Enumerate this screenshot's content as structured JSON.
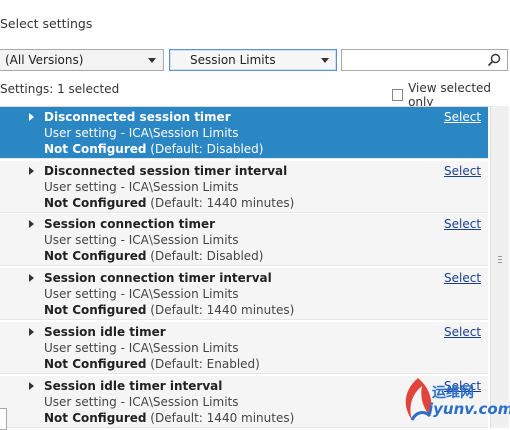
{
  "header": {
    "title": "Select settings"
  },
  "filters": {
    "version": "(All Versions)",
    "category": "Session Limits",
    "search_value": ""
  },
  "status": {
    "settings_count": "Settings:  1 selected",
    "view_selected_label": "View selected only"
  },
  "settings": [
    {
      "name": "Disconnected session timer",
      "path": "User setting - ICA\\Session Limits",
      "state_bold": "Not Configured",
      "state_default": " (Default: Disabled)",
      "action": "Select"
    },
    {
      "name": "Disconnected session timer interval",
      "path": "User setting - ICA\\Session Limits",
      "state_bold": "Not Configured",
      "state_default": " (Default: 1440 minutes)",
      "action": "Select"
    },
    {
      "name": "Session connection timer",
      "path": "User setting - ICA\\Session Limits",
      "state_bold": "Not Configured",
      "state_default": " (Default: Disabled)",
      "action": "Select"
    },
    {
      "name": "Session connection timer interval",
      "path": "User setting - ICA\\Session Limits",
      "state_bold": "Not Configured",
      "state_default": " (Default: 1440 minutes)",
      "action": "Select"
    },
    {
      "name": "Session idle timer",
      "path": "User setting - ICA\\Session Limits",
      "state_bold": "Not Configured",
      "state_default": " (Default: Enabled)",
      "action": "Select"
    },
    {
      "name": "Session idle timer interval",
      "path": "User setting - ICA\\Session Limits",
      "state_bold": "Not Configured",
      "state_default": " (Default: 1440 minutes)",
      "action": "Select"
    }
  ],
  "watermark": {
    "line1": "运维网",
    "line2": "iyunv.com"
  },
  "colors": {
    "selected_row": "#2b86c4",
    "row_bg": "#f5f5f5",
    "link": "#1a3f8f"
  }
}
